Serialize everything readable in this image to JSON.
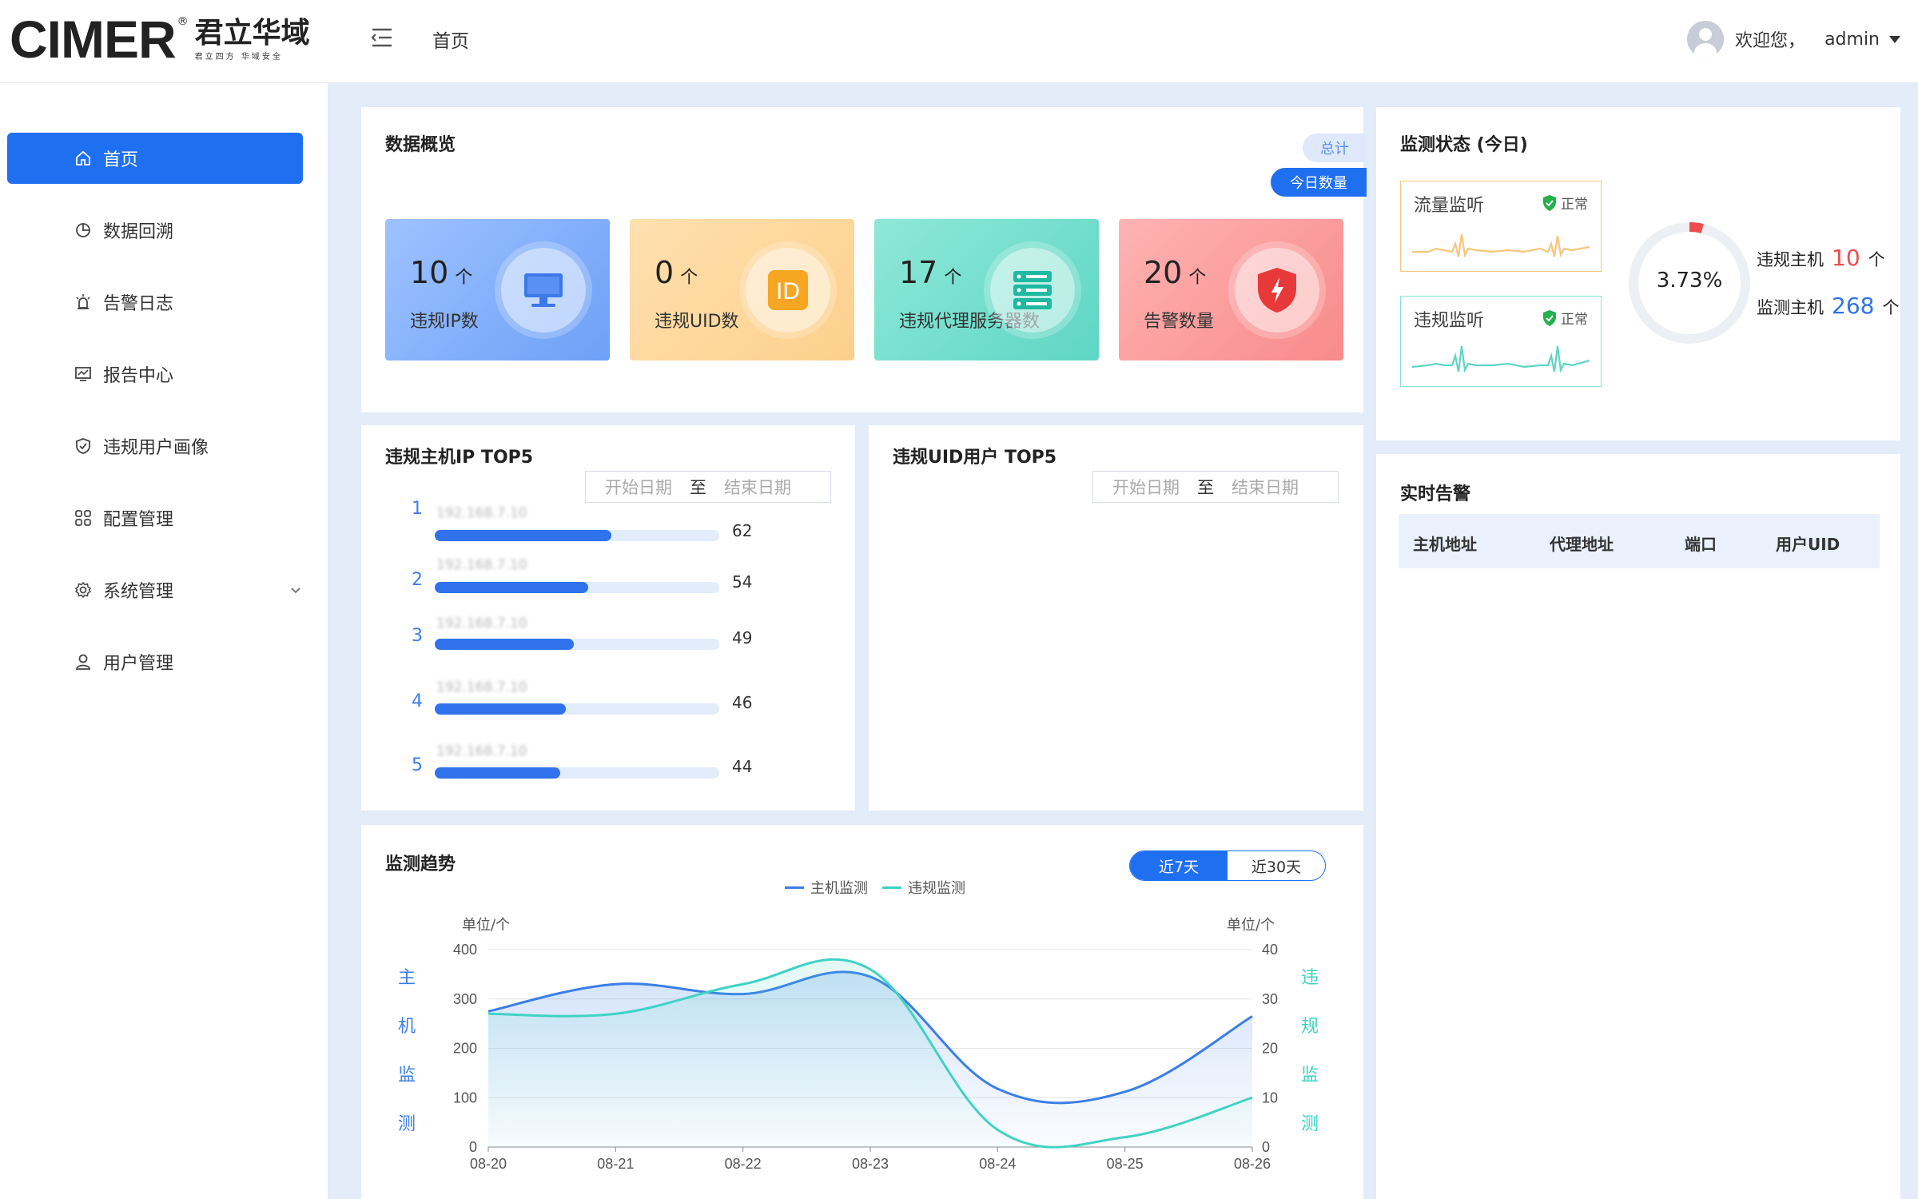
{
  "header": {
    "logo_text": "CIMER",
    "logo_reg": "®",
    "logo_cn": "君立华域",
    "logo_cn_sub": "君立四方 华域安全",
    "breadcrumb": "首页",
    "greeting": "欢迎您，",
    "username": "admin"
  },
  "sidebar": {
    "items": [
      {
        "label": "首页",
        "icon": "home-icon"
      },
      {
        "label": "数据回溯",
        "icon": "pie-chart-icon"
      },
      {
        "label": "告警日志",
        "icon": "alarm-light-icon"
      },
      {
        "label": "报告中心",
        "icon": "report-monitor-icon"
      },
      {
        "label": "违规用户画像",
        "icon": "shield-check-icon"
      },
      {
        "label": "配置管理",
        "icon": "grid-icon"
      },
      {
        "label": "系统管理",
        "icon": "gear-icon"
      },
      {
        "label": "用户管理",
        "icon": "user-icon"
      }
    ]
  },
  "overview": {
    "title": "数据概览",
    "tab_total": "总计",
    "tab_today": "今日数量",
    "stats": [
      {
        "value": "10",
        "unit": "个",
        "label": "违规IP数",
        "icon": "monitor-icon"
      },
      {
        "value": "0",
        "unit": "个",
        "label": "违规UID数",
        "icon": "id-icon"
      },
      {
        "value": "17",
        "unit": "个",
        "label": "违规代理服务器数",
        "icon": "server-icon"
      },
      {
        "value": "20",
        "unit": "个",
        "label": "告警数量",
        "icon": "shield-alert-icon"
      }
    ]
  },
  "top_ip": {
    "title": "违规主机IP TOP5",
    "start_placeholder": "开始日期",
    "sep": "至",
    "end_placeholder": "结束日期",
    "rows": [
      {
        "rank": "1",
        "ip": "192.168.7.10",
        "value": 62
      },
      {
        "rank": "2",
        "ip": "192.168.7.10",
        "value": 54
      },
      {
        "rank": "3",
        "ip": "192.168.7.10",
        "value": 49
      },
      {
        "rank": "4",
        "ip": "192.168.7.10",
        "value": 46
      },
      {
        "rank": "5",
        "ip": "192.168.7.10",
        "value": 44
      }
    ]
  },
  "top_uid": {
    "title": "违规UID用户 TOP5",
    "start_placeholder": "开始日期",
    "sep": "至",
    "end_placeholder": "结束日期"
  },
  "trend": {
    "title": "监测趋势",
    "btn_7": "近7天",
    "btn_30": "近30天",
    "legend_host": "主机监测",
    "legend_viol": "违规监测",
    "unit_left": "单位/个",
    "unit_right": "单位/个",
    "left_axis_chars": [
      "主",
      "机",
      "监",
      "测"
    ],
    "right_axis_chars": [
      "违",
      "规",
      "监",
      "测"
    ]
  },
  "chart_data": {
    "type": "line",
    "x": [
      "08-20",
      "08-21",
      "08-22",
      "08-23",
      "08-24",
      "08-25",
      "08-26"
    ],
    "series": [
      {
        "name": "主机监测",
        "axis": "left",
        "color": "#3b7ee8",
        "values": [
          275,
          330,
          310,
          345,
          118,
          112,
          265
        ]
      },
      {
        "name": "违规监测",
        "axis": "right",
        "color": "#3fd3c4",
        "values": [
          27,
          27,
          33,
          36,
          3.5,
          2,
          10
        ]
      }
    ],
    "ylim_left": [
      0,
      400
    ],
    "ylim_right": [
      0,
      40
    ],
    "yticks_left": [
      0,
      100,
      200,
      300,
      400
    ],
    "yticks_right": [
      0,
      10,
      20,
      30,
      40
    ],
    "grid": true,
    "legend": "top-center"
  },
  "monitor": {
    "title": "监测状态 (今日)",
    "boxes": [
      {
        "label": "流量监听",
        "status": "正常"
      },
      {
        "label": "违规监听",
        "status": "正常"
      }
    ],
    "ratio_text": "3.73%",
    "ratio": 0.0373,
    "viol_label": "违规主机",
    "viol_value": "10",
    "host_label": "监测主机",
    "host_value": "268",
    "unit": "个"
  },
  "alerts": {
    "title": "实时告警",
    "columns": [
      "主机地址",
      "代理地址",
      "端口",
      "用户UID"
    ]
  },
  "colors": {
    "primary": "#1f6ff1",
    "violation_red": "#ef4c4c",
    "host_blue": "#2f72ec"
  }
}
